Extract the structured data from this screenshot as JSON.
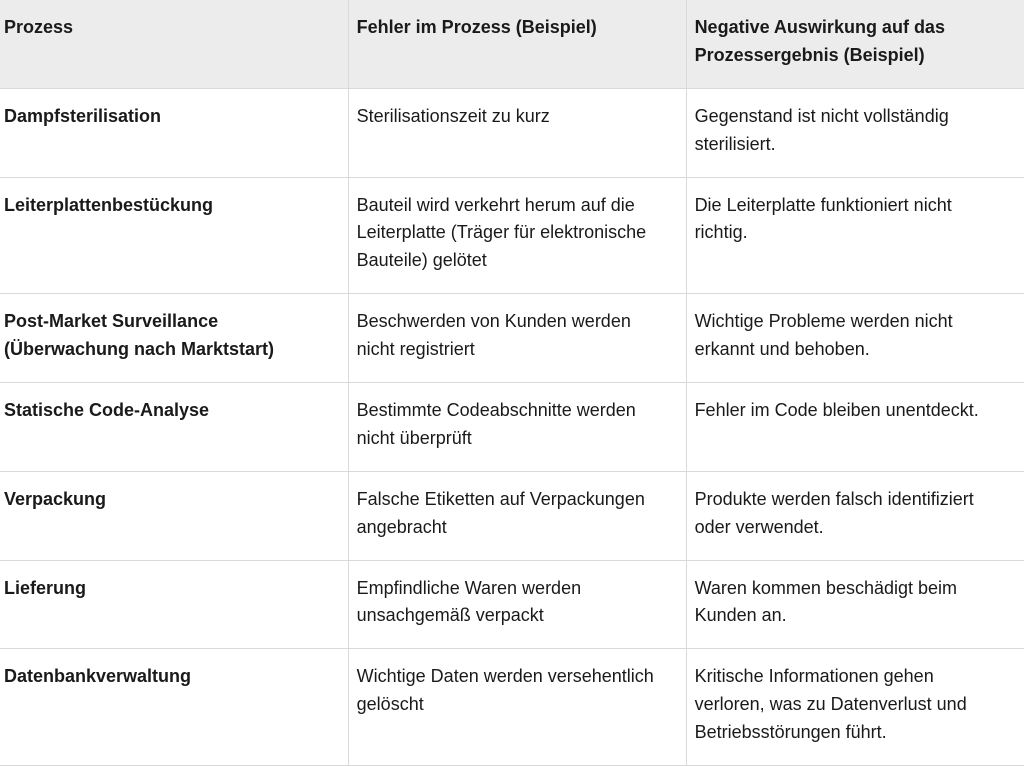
{
  "table": {
    "headers": [
      "Prozess",
      "Fehler im Prozess (Beispiel)",
      "Negative Auswirkung auf das Prozessergebnis (Beispiel)"
    ],
    "rows": [
      {
        "process": "Dampfsterilisation",
        "failure": "Sterilisationszeit zu kurz",
        "impact": "Gegenstand ist nicht vollständig sterilisiert."
      },
      {
        "process": "Leiterplattenbestückung",
        "failure": "Bauteil wird verkehrt herum auf die Leiterplatte (Träger für elektronische Bauteile) gelötet",
        "impact": "Die Leiterplatte funktioniert nicht richtig."
      },
      {
        "process": "Post-Market Surveillance (Überwachung nach Marktstart)",
        "failure": "Beschwerden von Kunden werden nicht registriert",
        "impact": "Wichtige Probleme werden nicht erkannt und behoben."
      },
      {
        "process": "Statische Code-Analyse",
        "failure": "Bestimmte Codeabschnitte werden nicht überprüft",
        "impact": "Fehler im Code bleiben unentdeckt."
      },
      {
        "process": "Verpackung",
        "failure": "Falsche Etiketten auf Verpackungen angebracht",
        "impact": "Produkte werden falsch identifiziert oder verwendet."
      },
      {
        "process": "Lieferung",
        "failure": "Empfindliche Waren werden unsachgemäß verpackt",
        "impact": "Waren kommen beschädigt beim Kunden an."
      },
      {
        "process": "Datenbankverwaltung",
        "failure": "Wichtige Daten werden versehentlich gelöscht",
        "impact": "Kritische Informationen gehen verloren, was zu Datenverlust und Betriebsstörungen führt."
      }
    ]
  }
}
